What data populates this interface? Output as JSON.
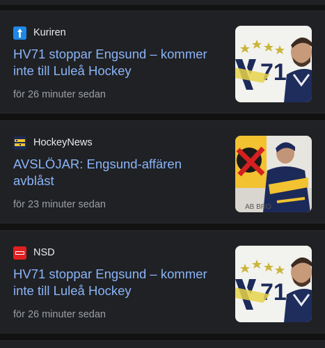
{
  "articles": [
    {
      "source": "Kuriren",
      "source_icon": "kuriren-logo-icon",
      "source_color": "#1e88e5",
      "headline": "HV71 stoppar Engsund – kommer inte till Luleå Hockey",
      "timestamp": "för 26 minuter sedan",
      "thumbnail": "hv71-player-photo"
    },
    {
      "source": "HockeyNews",
      "source_icon": "hockeynews-logo-icon",
      "source_color": "#1a2a55",
      "headline": "AVSLÖJAR: Engsund-affären avblåst",
      "timestamp": "för 23 minuter sedan",
      "thumbnail": "hv71-player-action-photo"
    },
    {
      "source": "NSD",
      "source_icon": "nsd-logo-icon",
      "source_color": "#e02020",
      "headline": "HV71 stoppar Engsund – kommer inte till Luleå Hockey",
      "timestamp": "för 26 minuter sedan",
      "thumbnail": "hv71-player-photo"
    }
  ],
  "colors": {
    "background": "#121212",
    "card": "#202124",
    "headline": "#8ab4f8",
    "source_text": "#e8eaed",
    "timestamp": "#9aa0a6"
  }
}
